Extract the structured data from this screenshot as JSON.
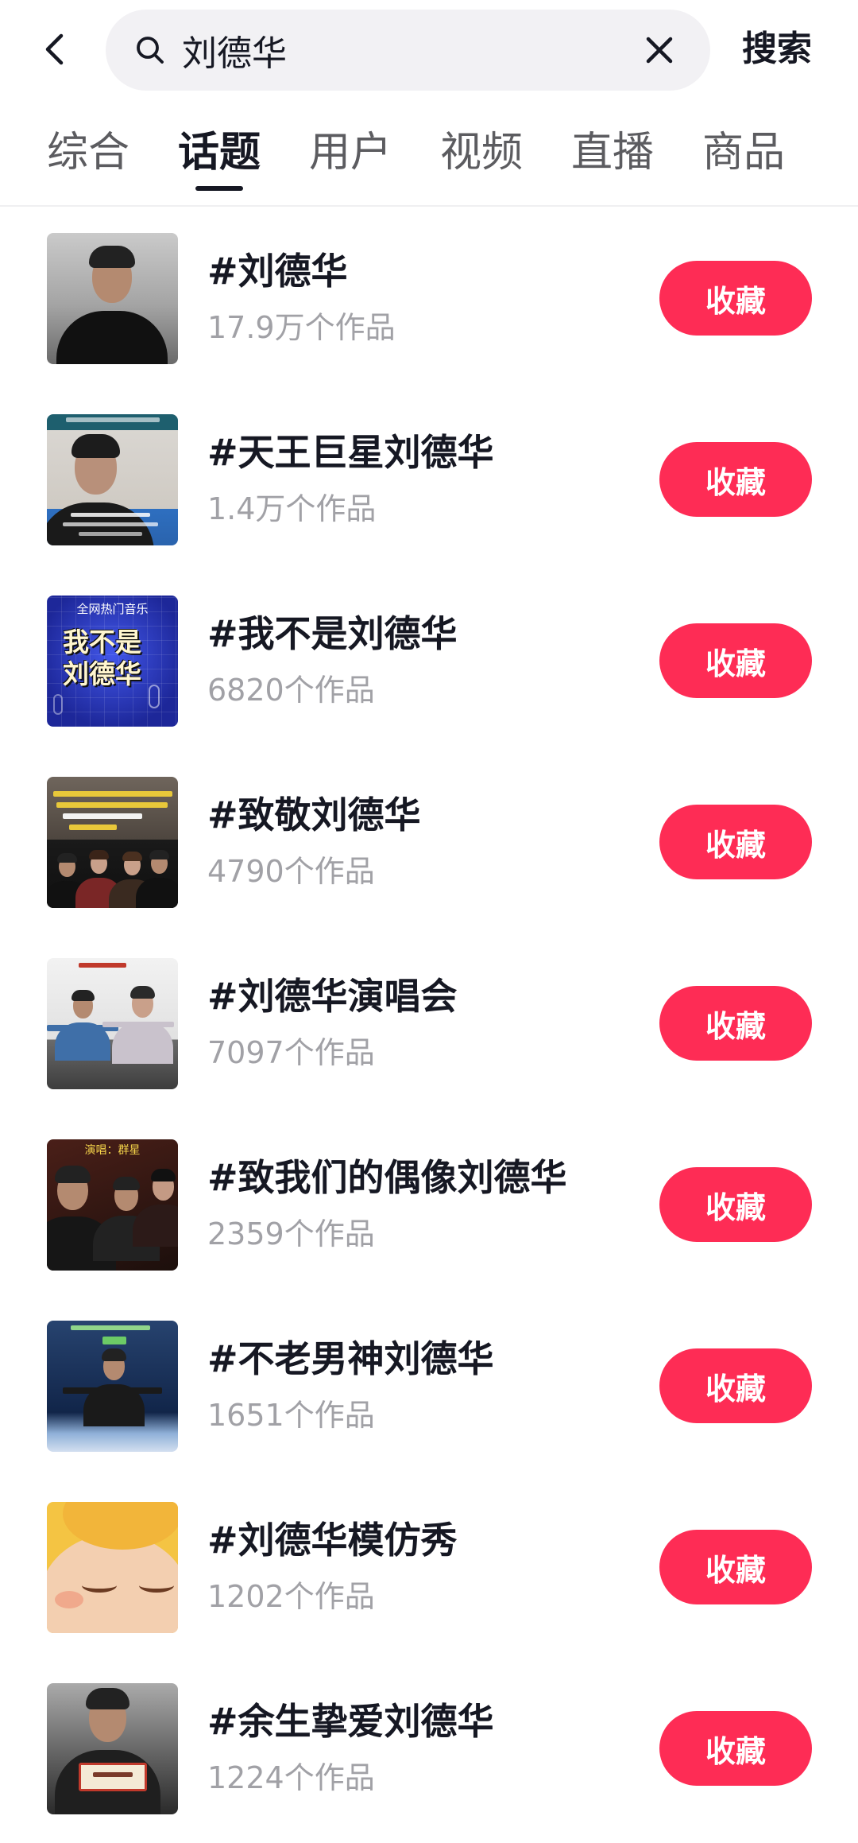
{
  "theme": {
    "accent": "#FE2C55",
    "text": "#161823",
    "subtext": "#A1A1A6",
    "search_bg": "#F2F1F4"
  },
  "header": {
    "back_icon": "chevron-left-icon",
    "search": {
      "icon": "search-icon",
      "query": "刘德华",
      "clear_icon": "close-icon"
    },
    "search_button": "搜索"
  },
  "tabs": [
    {
      "label": "综合",
      "active": false
    },
    {
      "label": "话题",
      "active": true
    },
    {
      "label": "用户",
      "active": false
    },
    {
      "label": "视频",
      "active": false
    },
    {
      "label": "直播",
      "active": false
    },
    {
      "label": "商品",
      "active": false
    }
  ],
  "topics": [
    {
      "title": "#刘德华",
      "count": "17.9万个作品",
      "button": "收藏"
    },
    {
      "title": "#天王巨星刘德华",
      "count": "1.4万个作品",
      "button": "收藏"
    },
    {
      "title": "#我不是刘德华",
      "count": "6820个作品",
      "button": "收藏",
      "thumb_text": [
        "全网热门音乐",
        "我不是",
        "刘德华"
      ]
    },
    {
      "title": "#致敬刘德华",
      "count": "4790个作品",
      "button": "收藏"
    },
    {
      "title": "#刘德华演唱会",
      "count": "7097个作品",
      "button": "收藏"
    },
    {
      "title": "#致我们的偶像刘德华",
      "count": "2359个作品",
      "button": "收藏",
      "thumb_text": [
        "演唱：群星"
      ]
    },
    {
      "title": "#不老男神刘德华",
      "count": "1651个作品",
      "button": "收藏"
    },
    {
      "title": "#刘德华模仿秀",
      "count": "1202个作品",
      "button": "收藏"
    },
    {
      "title": "#余生挚爱刘德华",
      "count": "1224个作品",
      "button": "收藏"
    }
  ]
}
